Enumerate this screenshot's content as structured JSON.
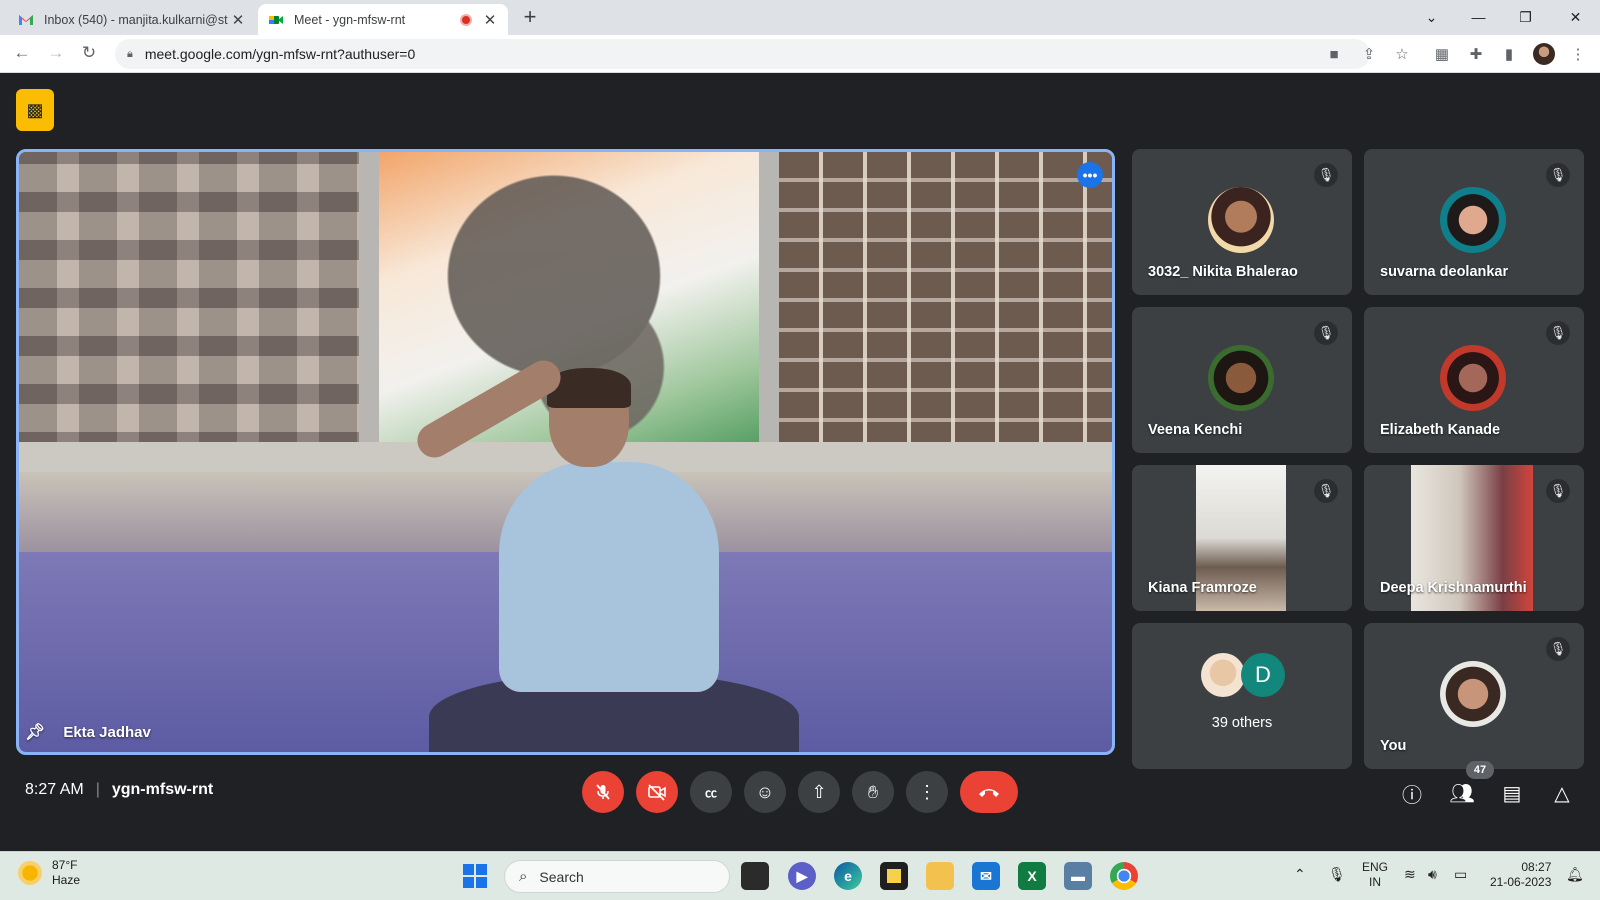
{
  "browser": {
    "tabs": [
      {
        "title": "Inbox (540) - manjita.kulkarni@st",
        "icon": "gmail-icon"
      },
      {
        "title": "Meet - ygn-mfsw-rnt",
        "icon": "meet-icon",
        "recording": true
      }
    ],
    "url": "meet.google.com/ygn-mfsw-rnt?authuser=0"
  },
  "meet": {
    "main_speaker": "Ekta Jadhav",
    "participants": [
      {
        "name": "3032_ Nikita Bhalerao",
        "muted": true
      },
      {
        "name": "suvarna deolankar",
        "muted": true
      },
      {
        "name": "Veena Kenchi",
        "muted": true
      },
      {
        "name": "Elizabeth Kanade",
        "muted": true
      },
      {
        "name": "Kiana Framroze",
        "muted": true
      },
      {
        "name": "Deepa Krishnamurthi",
        "muted": true
      },
      {
        "name": "39 others",
        "avatar_letter": "D"
      },
      {
        "name": "You",
        "muted": true
      }
    ],
    "time": "8:27 AM",
    "separator": "|",
    "meeting_code": "ygn-mfsw-rnt",
    "people_count": "47"
  },
  "taskbar": {
    "weather_temp": "87°F",
    "weather_desc": "Haze",
    "search_placeholder": "Search",
    "lang_top": "ENG",
    "lang_bottom": "IN",
    "time": "08:27",
    "date": "21-06-2023"
  },
  "colors": {
    "meet_bg": "#202124",
    "tile_bg": "#3c4043",
    "end_call": "#ea4335",
    "active_border": "#8ab4f8",
    "taskbar_bg": "#dfe9e4"
  }
}
